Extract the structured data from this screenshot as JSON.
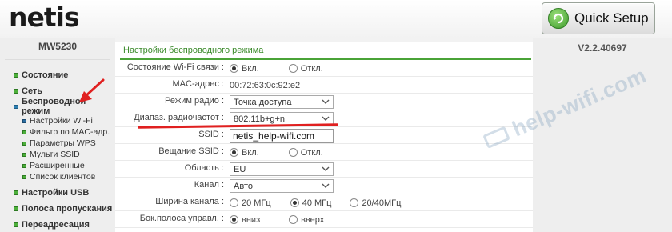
{
  "header": {
    "logo": "netis",
    "quick_setup": "Quick Setup"
  },
  "sidebar": {
    "model": "MW5230",
    "menu": [
      {
        "label": "Состояние"
      },
      {
        "label": "Сеть"
      },
      {
        "label": "Беспроводной режим"
      },
      {
        "label": "Настройки USB"
      },
      {
        "label": "Полоса пропускания"
      },
      {
        "label": "Переадресация"
      }
    ],
    "submenu": [
      {
        "label": "Настройки Wi-Fi"
      },
      {
        "label": "Фильтр по MAC-адр."
      },
      {
        "label": "Параметры WPS"
      },
      {
        "label": "Мульти SSID"
      },
      {
        "label": "Расширенные"
      },
      {
        "label": "Список клиентов"
      }
    ]
  },
  "main": {
    "title": "Настройки беспроводного режима",
    "rows": {
      "wifi_state": {
        "label": "Состояние Wi-Fi связи :",
        "on": "Вкл.",
        "off": "Откл."
      },
      "mac": {
        "label": "MAC-адрес :",
        "value": "00:72:63:0c:92:e2"
      },
      "radio_mode": {
        "label": "Режим радио :",
        "value": "Точка доступа"
      },
      "band": {
        "label": "Диапаз. радиочастот :",
        "value": "802.11b+g+n"
      },
      "ssid": {
        "label": "SSID :",
        "value": "netis_help-wifi.com"
      },
      "ssid_broadcast": {
        "label": "Вещание SSID :",
        "on": "Вкл.",
        "off": "Откл."
      },
      "region": {
        "label": "Область :",
        "value": "EU"
      },
      "channel": {
        "label": "Канал :",
        "value": "Авто"
      },
      "bandwidth": {
        "label": "Ширина канала :",
        "opt1": "20 МГц",
        "opt2": "40 МГц",
        "opt3": "20/40МГц"
      },
      "sideband": {
        "label": "Бок.полоса управл. :",
        "opt1": "вниз",
        "opt2": "вверх"
      }
    }
  },
  "right": {
    "version": "V2.2.40697"
  },
  "watermark": "help-wifi.com",
  "colors": {
    "accent_green": "#4aa337",
    "title_green": "#3a8a2a",
    "annotation_red": "#e02020"
  }
}
